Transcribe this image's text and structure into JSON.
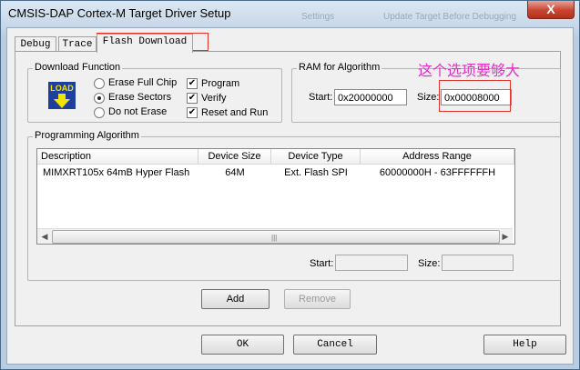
{
  "window": {
    "title": "CMSIS-DAP Cortex-M Target Driver Setup",
    "close_glyph": "X",
    "bg_title_1": "Settings",
    "bg_title_2": "Update Target Before Debugging"
  },
  "tabs": [
    {
      "label": "Debug"
    },
    {
      "label": "Trace"
    },
    {
      "label": "Flash Download"
    }
  ],
  "download_function": {
    "label": "Download Function",
    "icon_text": "LOAD",
    "options": [
      {
        "label": "Erase Full Chip",
        "selected": false
      },
      {
        "label": "Erase Sectors",
        "selected": true
      },
      {
        "label": "Do not Erase",
        "selected": false
      }
    ],
    "checks": [
      {
        "label": "Program",
        "checked": true
      },
      {
        "label": "Verify",
        "checked": true
      },
      {
        "label": "Reset and Run",
        "checked": true
      }
    ]
  },
  "ram": {
    "label": "RAM for Algorithm",
    "start_label": "Start:",
    "start_value": "0x20000000",
    "size_label": "Size:",
    "size_value": "0x00008000"
  },
  "annotation": "这个选项要够大",
  "algorithm": {
    "label": "Programming Algorithm",
    "columns": [
      "Description",
      "Device Size",
      "Device Type",
      "Address Range"
    ],
    "rows": [
      [
        "MIMXRT105x 64mB Hyper Flash",
        "64M",
        "Ext. Flash SPI",
        "60000000H - 63FFFFFFH"
      ]
    ],
    "start_label": "Start:",
    "size_label": "Size:"
  },
  "buttons": {
    "add": "Add",
    "remove": "Remove",
    "ok": "OK",
    "cancel": "Cancel",
    "help": "Help"
  },
  "colors": {
    "annotation": "#e52dc8",
    "highlight": "#e0322c",
    "load_icon_bg": "#1f3f9c",
    "load_icon_fg": "#f2e400"
  }
}
